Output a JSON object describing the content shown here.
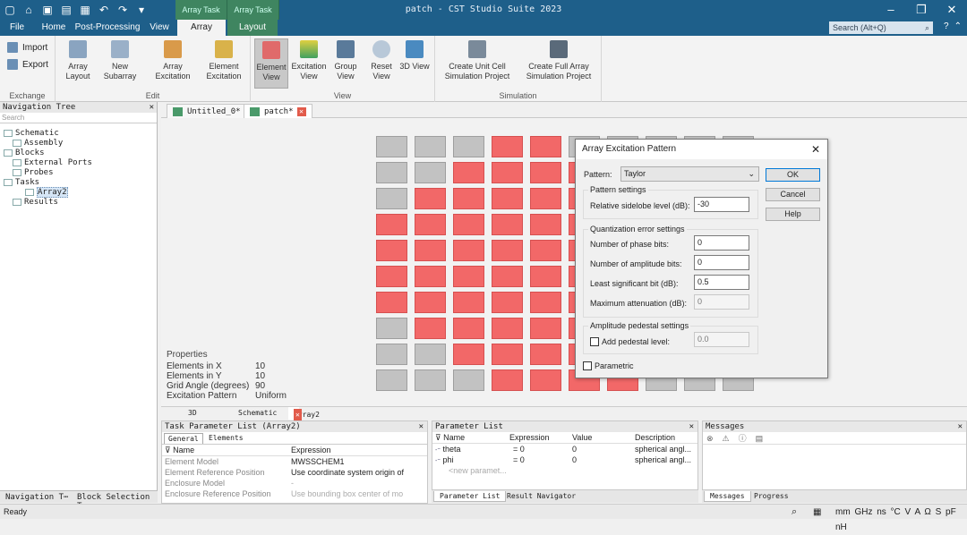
{
  "titlebar": {
    "app_title": "patch - CST Studio Suite 2023",
    "context_tabs": [
      "Array Task",
      "Array Task"
    ]
  },
  "menu": {
    "tabs": [
      "File",
      "Home",
      "Post-Processing",
      "View",
      "Array",
      "Layout"
    ],
    "active": "Array",
    "search_placeholder": "Search (Alt+Q)"
  },
  "ribbon": {
    "exchange": {
      "label": "Exchange",
      "import": "Import",
      "export": "Export"
    },
    "edit": {
      "label": "Edit",
      "array_layout": "Array Layout",
      "new_subarray": "New Subarray",
      "array_excitation": "Array Excitation",
      "element_excitation": "Element Excitation"
    },
    "view": {
      "label": "View",
      "element_view": "Element View",
      "excitation_view": "Excitation View",
      "group_view": "Group View",
      "reset_view": "Reset View",
      "view_3d": "3D View"
    },
    "simulation": {
      "label": "Simulation",
      "unit_cell": "Create Unit Cell Simulation Project",
      "full_array": "Create Full Array Simulation Project"
    }
  },
  "nav": {
    "title": "Navigation Tree",
    "search_placeholder": "Search",
    "items": [
      "Schematic",
      "Assembly",
      "Blocks",
      "External Ports",
      "Probes",
      "Tasks",
      "Array2",
      "Results"
    ],
    "bottom_tabs": [
      "Navigation T⋯",
      "Block Selection T⋯"
    ]
  },
  "doc_tabs": [
    "Untitled_0*",
    "patch*"
  ],
  "array": {
    "rows": [
      [
        0,
        0,
        0,
        1,
        1,
        0,
        0,
        0,
        0,
        0
      ],
      [
        0,
        0,
        1,
        1,
        1,
        1,
        0,
        0,
        0,
        0
      ],
      [
        0,
        1,
        1,
        1,
        1,
        1,
        0,
        0,
        0,
        0
      ],
      [
        1,
        1,
        1,
        1,
        1,
        1,
        0,
        0,
        0,
        0
      ],
      [
        1,
        1,
        1,
        1,
        1,
        1,
        0,
        0,
        0,
        0
      ],
      [
        1,
        1,
        1,
        1,
        1,
        1,
        0,
        0,
        0,
        0
      ],
      [
        1,
        1,
        1,
        1,
        1,
        1,
        0,
        0,
        0,
        0
      ],
      [
        0,
        1,
        1,
        1,
        1,
        1,
        0,
        0,
        0,
        0
      ],
      [
        0,
        0,
        1,
        1,
        1,
        1,
        0,
        0,
        0,
        0
      ],
      [
        0,
        0,
        0,
        1,
        1,
        1,
        1,
        0,
        0,
        0
      ]
    ],
    "on_color": "#f26868",
    "off_color": "#c2c2c2"
  },
  "properties": {
    "title": "Properties",
    "rows": [
      {
        "k": "Elements in X",
        "v": "10"
      },
      {
        "k": "Elements in Y",
        "v": "10"
      },
      {
        "k": "Grid Angle (degrees)",
        "v": "90"
      },
      {
        "k": "Excitation Pattern",
        "v": "Uniform"
      }
    ]
  },
  "view_tabs": [
    "3D",
    "Schematic",
    "Array2"
  ],
  "task_params": {
    "title": "Task Parameter List (Array2)",
    "tabs": [
      "General",
      "Elements"
    ],
    "headers": [
      "Name",
      "Expression"
    ],
    "rows": [
      {
        "name": "Element Model",
        "expr": "MWSSCHEM1"
      },
      {
        "name": "Element Reference Position",
        "expr": "Use coordinate system origin of"
      },
      {
        "name": "Enclosure Model",
        "expr": "-"
      },
      {
        "name": "Enclosure Reference Position",
        "expr": "Use bounding box center of mo"
      }
    ]
  },
  "param_list": {
    "title": "Parameter List",
    "headers": [
      "Name",
      "Expression",
      "Value",
      "Description"
    ],
    "rows": [
      {
        "name": "theta",
        "expr": "= 0",
        "value": "0",
        "desc": "spherical angl..."
      },
      {
        "name": "phi",
        "expr": "= 0",
        "value": "0",
        "desc": "spherical angl..."
      }
    ],
    "new_row": "<new paramet...",
    "tabs": [
      "Parameter List",
      "Result Navigator"
    ]
  },
  "messages": {
    "title": "Messages",
    "tabs": [
      "Messages",
      "Progress"
    ]
  },
  "status": {
    "left": "Ready",
    "units": "mm GHz ns °C V A Ω S pF nH"
  },
  "dialog": {
    "title": "Array Excitation Pattern",
    "pattern_label": "Pattern:",
    "pattern_value": "Taylor",
    "ok": "OK",
    "cancel": "Cancel",
    "help": "Help",
    "pattern_settings": "Pattern settings",
    "sidelobe_label": "Relative sidelobe level (dB):",
    "sidelobe_value": "-30",
    "quant_settings": "Quantization error settings",
    "phase_bits_label": "Number of phase bits:",
    "phase_bits_value": "0",
    "amp_bits_label": "Number of amplitude bits:",
    "amp_bits_value": "0",
    "lsb_label": "Least significant bit (dB):",
    "lsb_value": "0.5",
    "max_att_label": "Maximum attenuation (dB):",
    "max_att_value": "0",
    "pedestal_settings": "Amplitude pedestal settings",
    "add_pedestal_label": "Add pedestal level:",
    "pedestal_value": "0.0",
    "parametric_label": "Parametric"
  }
}
